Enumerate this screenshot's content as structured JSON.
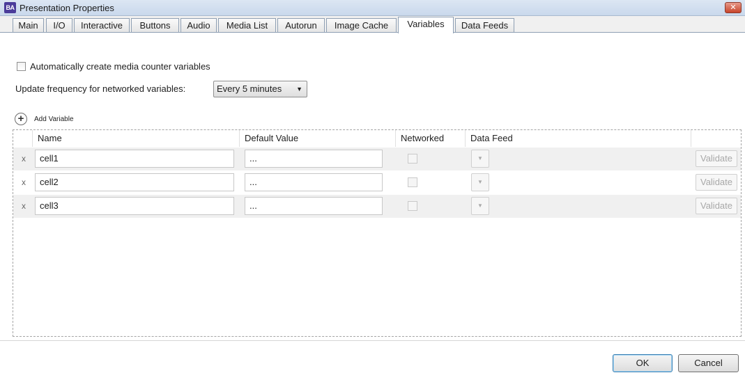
{
  "window": {
    "app_icon_text": "BA",
    "title": "Presentation Properties",
    "close_glyph": "✕"
  },
  "tabs": [
    {
      "label": "Main",
      "active": false
    },
    {
      "label": "I/O",
      "active": false
    },
    {
      "label": "Interactive",
      "active": false
    },
    {
      "label": "Buttons",
      "active": false
    },
    {
      "label": "Audio",
      "active": false
    },
    {
      "label": "Media List",
      "active": false
    },
    {
      "label": "Autorun",
      "active": false
    },
    {
      "label": "Image Cache",
      "active": false
    },
    {
      "label": "Variables",
      "active": true
    },
    {
      "label": "Data Feeds",
      "active": false
    }
  ],
  "options": {
    "auto_counter_label": "Automatically create media counter variables",
    "auto_counter_checked": false,
    "update_freq_label": "Update frequency for networked variables:",
    "update_freq_value": "Every 5 minutes",
    "dropdown_arrow": "▼"
  },
  "add_variable": {
    "icon": "+",
    "label": "Add Variable"
  },
  "grid": {
    "columns": [
      "Name",
      "Default Value",
      "Networked",
      "Data Feed"
    ],
    "rows": [
      {
        "delete": "x",
        "name": "cell1",
        "default_value": "...",
        "networked": false,
        "validate_label": "Validate"
      },
      {
        "delete": "x",
        "name": "cell2",
        "default_value": "...",
        "networked": false,
        "validate_label": "Validate"
      },
      {
        "delete": "x",
        "name": "cell3",
        "default_value": "...",
        "networked": false,
        "validate_label": "Validate"
      }
    ],
    "data_feed_arrow": "▼"
  },
  "buttons": {
    "ok": "OK",
    "cancel": "Cancel"
  }
}
